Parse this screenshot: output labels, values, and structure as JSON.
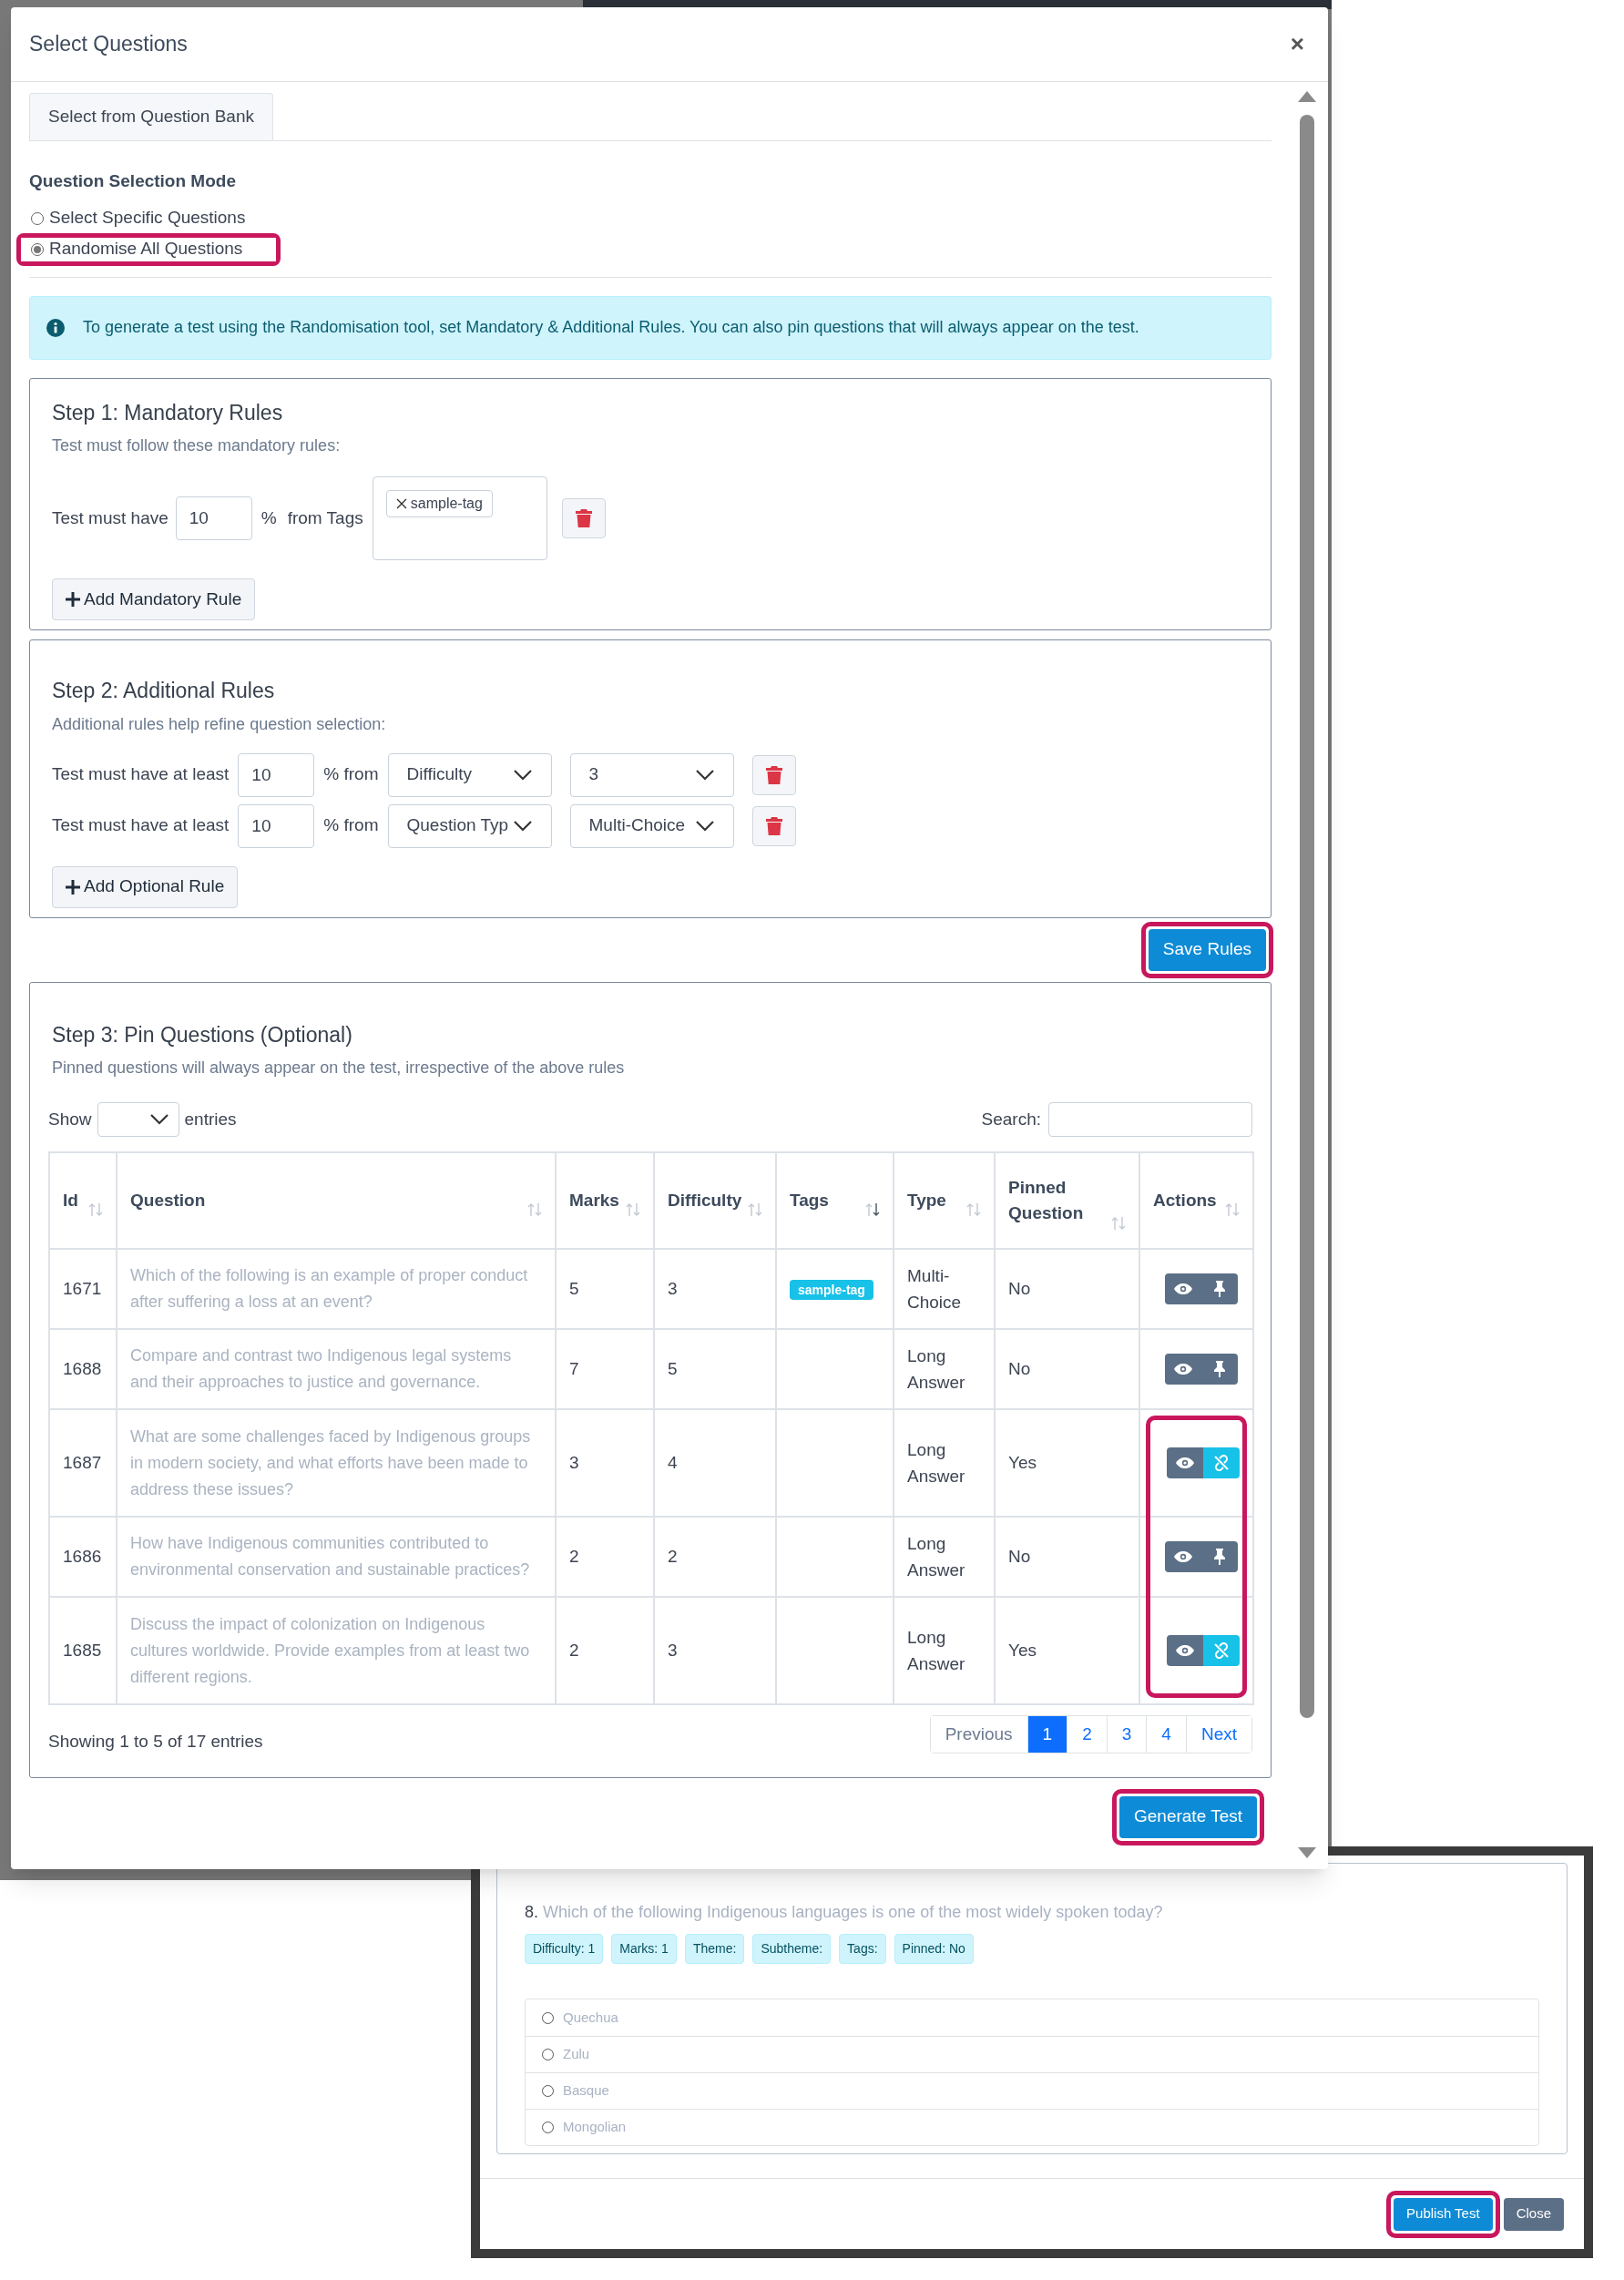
{
  "modal": {
    "title": "Select Questions",
    "close": "×",
    "tabs": [
      {
        "label": "Select from Question Bank",
        "selected": true
      }
    ],
    "mode": {
      "label": "Question Selection Mode",
      "options": [
        {
          "label": "Select Specific Questions",
          "selected": false,
          "highlighted": false
        },
        {
          "label": "Randomise All Questions",
          "selected": true,
          "highlighted": true
        }
      ]
    },
    "info": "To generate a test using the Randomisation tool, set Mandatory & Additional Rules. You can also pin questions that will always appear on the test.",
    "step1": {
      "title": "Step 1: Mandatory Rules",
      "subtitle": "Test must follow these mandatory rules:",
      "rules": [
        {
          "prefix": "Test must have",
          "value": "10",
          "unit": "%",
          "source": "from Tags",
          "tags": [
            "sample-tag"
          ]
        }
      ],
      "add_button": "Add Mandatory Rule"
    },
    "step2": {
      "title": "Step 2: Additional Rules",
      "subtitle": "Additional rules help refine question selection:",
      "rules": [
        {
          "prefix": "Test must have at least",
          "value": "10",
          "unit": "% from",
          "category": "Difficulty",
          "option": "3"
        },
        {
          "prefix": "Test must have at least",
          "value": "10",
          "unit": "% from",
          "category": "Question Typ",
          "option": "Multi-Choice"
        }
      ],
      "add_button": "Add Optional Rule"
    },
    "save_button": {
      "label": "Save Rules",
      "highlighted": true
    },
    "step3": {
      "title": "Step 3: Pin Questions (Optional)",
      "subtitle": "Pinned questions will always appear on the test, irrespective of the above rules",
      "show_label": "Show",
      "entries_label": "entries",
      "search_label": "Search:",
      "columns": [
        {
          "label": "Id",
          "sorted_desc": false
        },
        {
          "label": "Question",
          "sorted_desc": false
        },
        {
          "label": "Marks",
          "sorted_desc": false
        },
        {
          "label": "Difficulty",
          "sorted_desc": false
        },
        {
          "label": "Tags",
          "sorted_desc": true
        },
        {
          "label": "Type",
          "sorted_desc": false
        },
        {
          "label": "Pinned Question",
          "sorted_desc": false
        },
        {
          "label": "Actions",
          "sorted_desc": false
        }
      ],
      "rows": [
        {
          "id": "1671",
          "question": "Which of the following is an example of proper conduct after suffering a loss at an event?",
          "marks": "5",
          "difficulty": "3",
          "tags": [
            "sample-tag"
          ],
          "type": "Multi-Choice",
          "pinned_text": "No",
          "pinned": false,
          "highlighted": false
        },
        {
          "id": "1688",
          "question": "Compare and contrast two Indigenous legal systems and their approaches to justice and governance.",
          "marks": "7",
          "difficulty": "5",
          "tags": [],
          "type": "Long Answer",
          "pinned_text": "No",
          "pinned": false,
          "highlighted": false
        },
        {
          "id": "1687",
          "question": "What are some challenges faced by Indigenous groups in modern society, and what efforts have been made to address these issues?",
          "marks": "3",
          "difficulty": "4",
          "tags": [],
          "type": "Long Answer",
          "pinned_text": "Yes",
          "pinned": true,
          "highlighted": true
        },
        {
          "id": "1686",
          "question": "How have Indigenous communities contributed to environmental conservation and sustainable practices?",
          "marks": "2",
          "difficulty": "2",
          "tags": [],
          "type": "Long Answer",
          "pinned_text": "No",
          "pinned": false,
          "highlighted": true
        },
        {
          "id": "1685",
          "question": "Discuss the impact of colonization on Indigenous cultures worldwide. Provide examples from at least two different regions.",
          "marks": "2",
          "difficulty": "3",
          "tags": [],
          "type": "Long Answer",
          "pinned_text": "Yes",
          "pinned": true,
          "highlighted": true
        }
      ],
      "summary": "Showing 1 to 5 of 17 entries",
      "pagination": [
        {
          "label": "Previous",
          "selected": false,
          "disabled": true
        },
        {
          "label": "1",
          "selected": true,
          "disabled": false
        },
        {
          "label": "2",
          "selected": false,
          "disabled": false
        },
        {
          "label": "3",
          "selected": false,
          "disabled": false
        },
        {
          "label": "4",
          "selected": false,
          "disabled": false
        },
        {
          "label": "Next",
          "selected": false,
          "disabled": false
        }
      ]
    },
    "generate_button": {
      "label": "Generate Test",
      "highlighted": true
    }
  },
  "preview": {
    "number": "8.",
    "question": "Which of the following Indigenous languages is one of the most widely spoken today?",
    "badges": [
      "Difficulty: 1",
      "Marks: 1",
      "Theme:",
      "Subtheme:",
      "Tags:",
      "Pinned: No"
    ],
    "options": [
      {
        "label": "Quechua",
        "selected": false
      },
      {
        "label": "Zulu",
        "selected": false
      },
      {
        "label": "Basque",
        "selected": false
      },
      {
        "label": "Mongolian",
        "selected": false
      }
    ],
    "buttons": [
      {
        "label": "Publish Test",
        "kind": "primary",
        "highlighted": true
      },
      {
        "label": "Close",
        "kind": "secondary",
        "highlighted": false
      }
    ]
  }
}
